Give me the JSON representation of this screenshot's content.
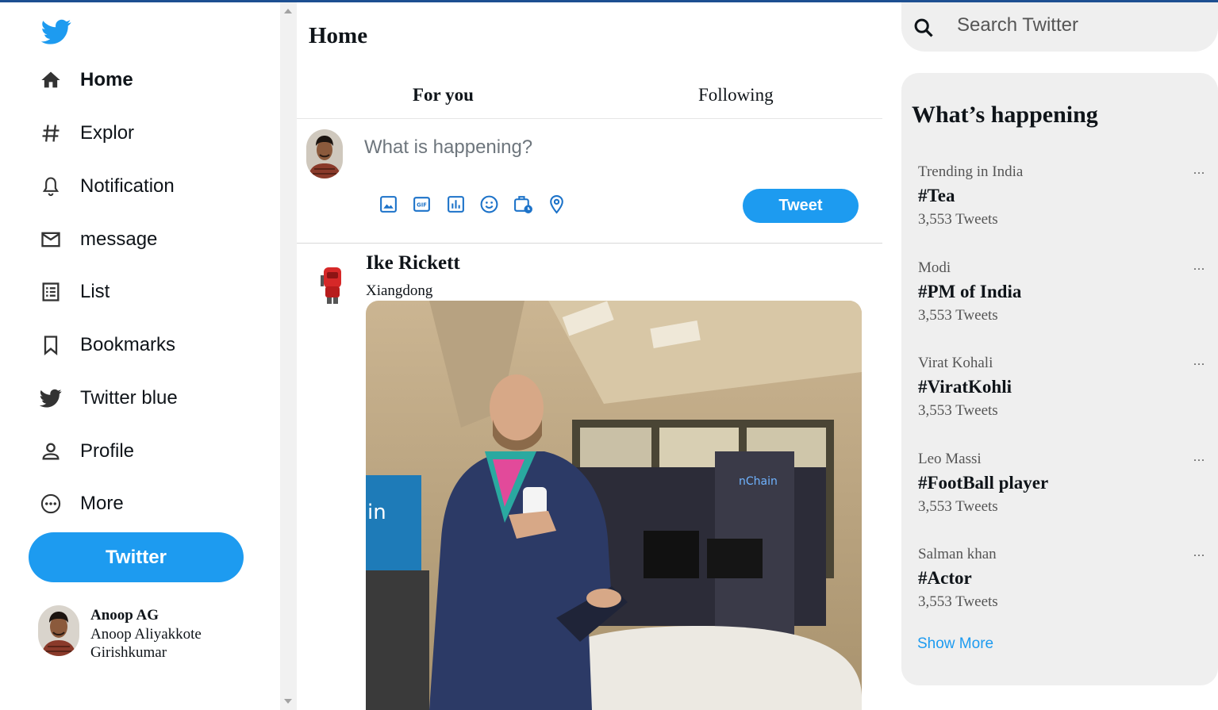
{
  "sidebar": {
    "items": [
      {
        "label": "Home",
        "icon": "home-icon",
        "active": true
      },
      {
        "label": "Explor",
        "icon": "hashtag-icon"
      },
      {
        "label": "Notification",
        "icon": "bell-icon"
      },
      {
        "label": "message",
        "icon": "mail-icon"
      },
      {
        "label": "List",
        "icon": "list-icon"
      },
      {
        "label": "Bookmarks",
        "icon": "bookmark-icon"
      },
      {
        "label": "Twitter blue",
        "icon": "twitter-bird-icon"
      },
      {
        "label": "Profile",
        "icon": "person-icon"
      },
      {
        "label": "More",
        "icon": "more-circle-icon"
      }
    ],
    "twitter_button": "Twitter",
    "account": {
      "name": "Anoop AG",
      "handle": "Anoop Aliyakkote Girishkumar"
    }
  },
  "main": {
    "title": "Home",
    "tabs": [
      {
        "label": "For you",
        "active": true
      },
      {
        "label": "Following"
      }
    ],
    "compose": {
      "placeholder": "What is happening?",
      "tools": [
        "image-icon",
        "gif-icon",
        "poll-icon",
        "emoji-icon",
        "schedule-icon",
        "location-icon"
      ],
      "tweet_button": "Tweet"
    },
    "post": {
      "name": "Ike Rickett",
      "handle": "Xiangdong"
    }
  },
  "right": {
    "search": {
      "placeholder": "Search Twitter"
    },
    "trends_title": "What’s happening",
    "trends": [
      {
        "category": "Trending in India",
        "tag": "#Tea",
        "count": "3,553 Tweets"
      },
      {
        "category": "Modi",
        "tag": "#PM of India",
        "count": "3,553 Tweets"
      },
      {
        "category": "Virat Kohali",
        "tag": "#ViratKohli",
        "count": "3,553 Tweets"
      },
      {
        "category": "Leo Massi",
        "tag": "#FootBall player",
        "count": "3,553 Tweets"
      },
      {
        "category": "Salman khan",
        "tag": "#Actor",
        "count": "3,553 Tweets"
      }
    ],
    "trend_more": "...",
    "show_more": "Show More"
  },
  "colors": {
    "accent": "#1d9bf0",
    "panel": "#efefef",
    "topline": "#1d4f91"
  }
}
